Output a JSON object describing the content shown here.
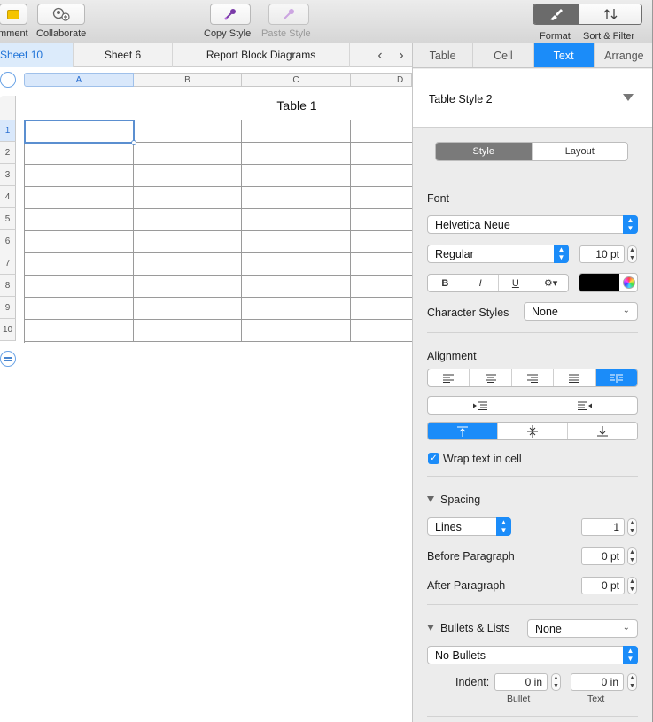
{
  "toolbar": {
    "comment_label": "mment",
    "collaborate_label": "Collaborate",
    "copy_style_label": "Copy Style",
    "paste_style_label": "Paste Style",
    "format_label": "Format",
    "sort_filter_label": "Sort & Filter"
  },
  "sheet_tabs": {
    "tabs": [
      {
        "label": "Sheet 10",
        "active": true
      },
      {
        "label": "Sheet 6",
        "active": false
      },
      {
        "label": "Report Block Diagrams",
        "active": false
      }
    ],
    "prev_glyph": "‹",
    "next_glyph": "›"
  },
  "spreadsheet": {
    "table_title": "Table 1",
    "columns": [
      "A",
      "B",
      "C",
      "D"
    ],
    "rows": [
      "1",
      "2",
      "3",
      "4",
      "5",
      "6",
      "7",
      "8",
      "9",
      "10"
    ],
    "selected_cell": "A1"
  },
  "inspector": {
    "tabs": [
      "Table",
      "Cell",
      "Text",
      "Arrange"
    ],
    "active_tab": "Text",
    "table_style": "Table Style 2",
    "style_layout": [
      "Style",
      "Layout"
    ],
    "font_section": "Font",
    "font_family": "Helvetica Neue",
    "font_weight": "Regular",
    "font_size": "10 pt",
    "text_buttons": [
      "B",
      "I",
      "U",
      "⚙▾"
    ],
    "text_color": "#000000",
    "character_styles_label": "Character Styles",
    "character_styles_value": "None",
    "alignment_label": "Alignment",
    "wrap_text_label": "Wrap text in cell",
    "wrap_text_checked": true,
    "spacing_label": "Spacing",
    "spacing_mode": "Lines",
    "spacing_value": "1",
    "before_paragraph_label": "Before Paragraph",
    "before_paragraph_value": "0 pt",
    "after_paragraph_label": "After Paragraph",
    "after_paragraph_value": "0 pt",
    "bullets_label": "Bullets & Lists",
    "bullets_value": "None",
    "bullet_type": "No Bullets",
    "indent_label": "Indent:",
    "bullet_indent": "0 in",
    "text_indent": "0 in",
    "bullet_caption": "Bullet",
    "text_caption": "Text",
    "accent_color": "#1b8cf9"
  }
}
